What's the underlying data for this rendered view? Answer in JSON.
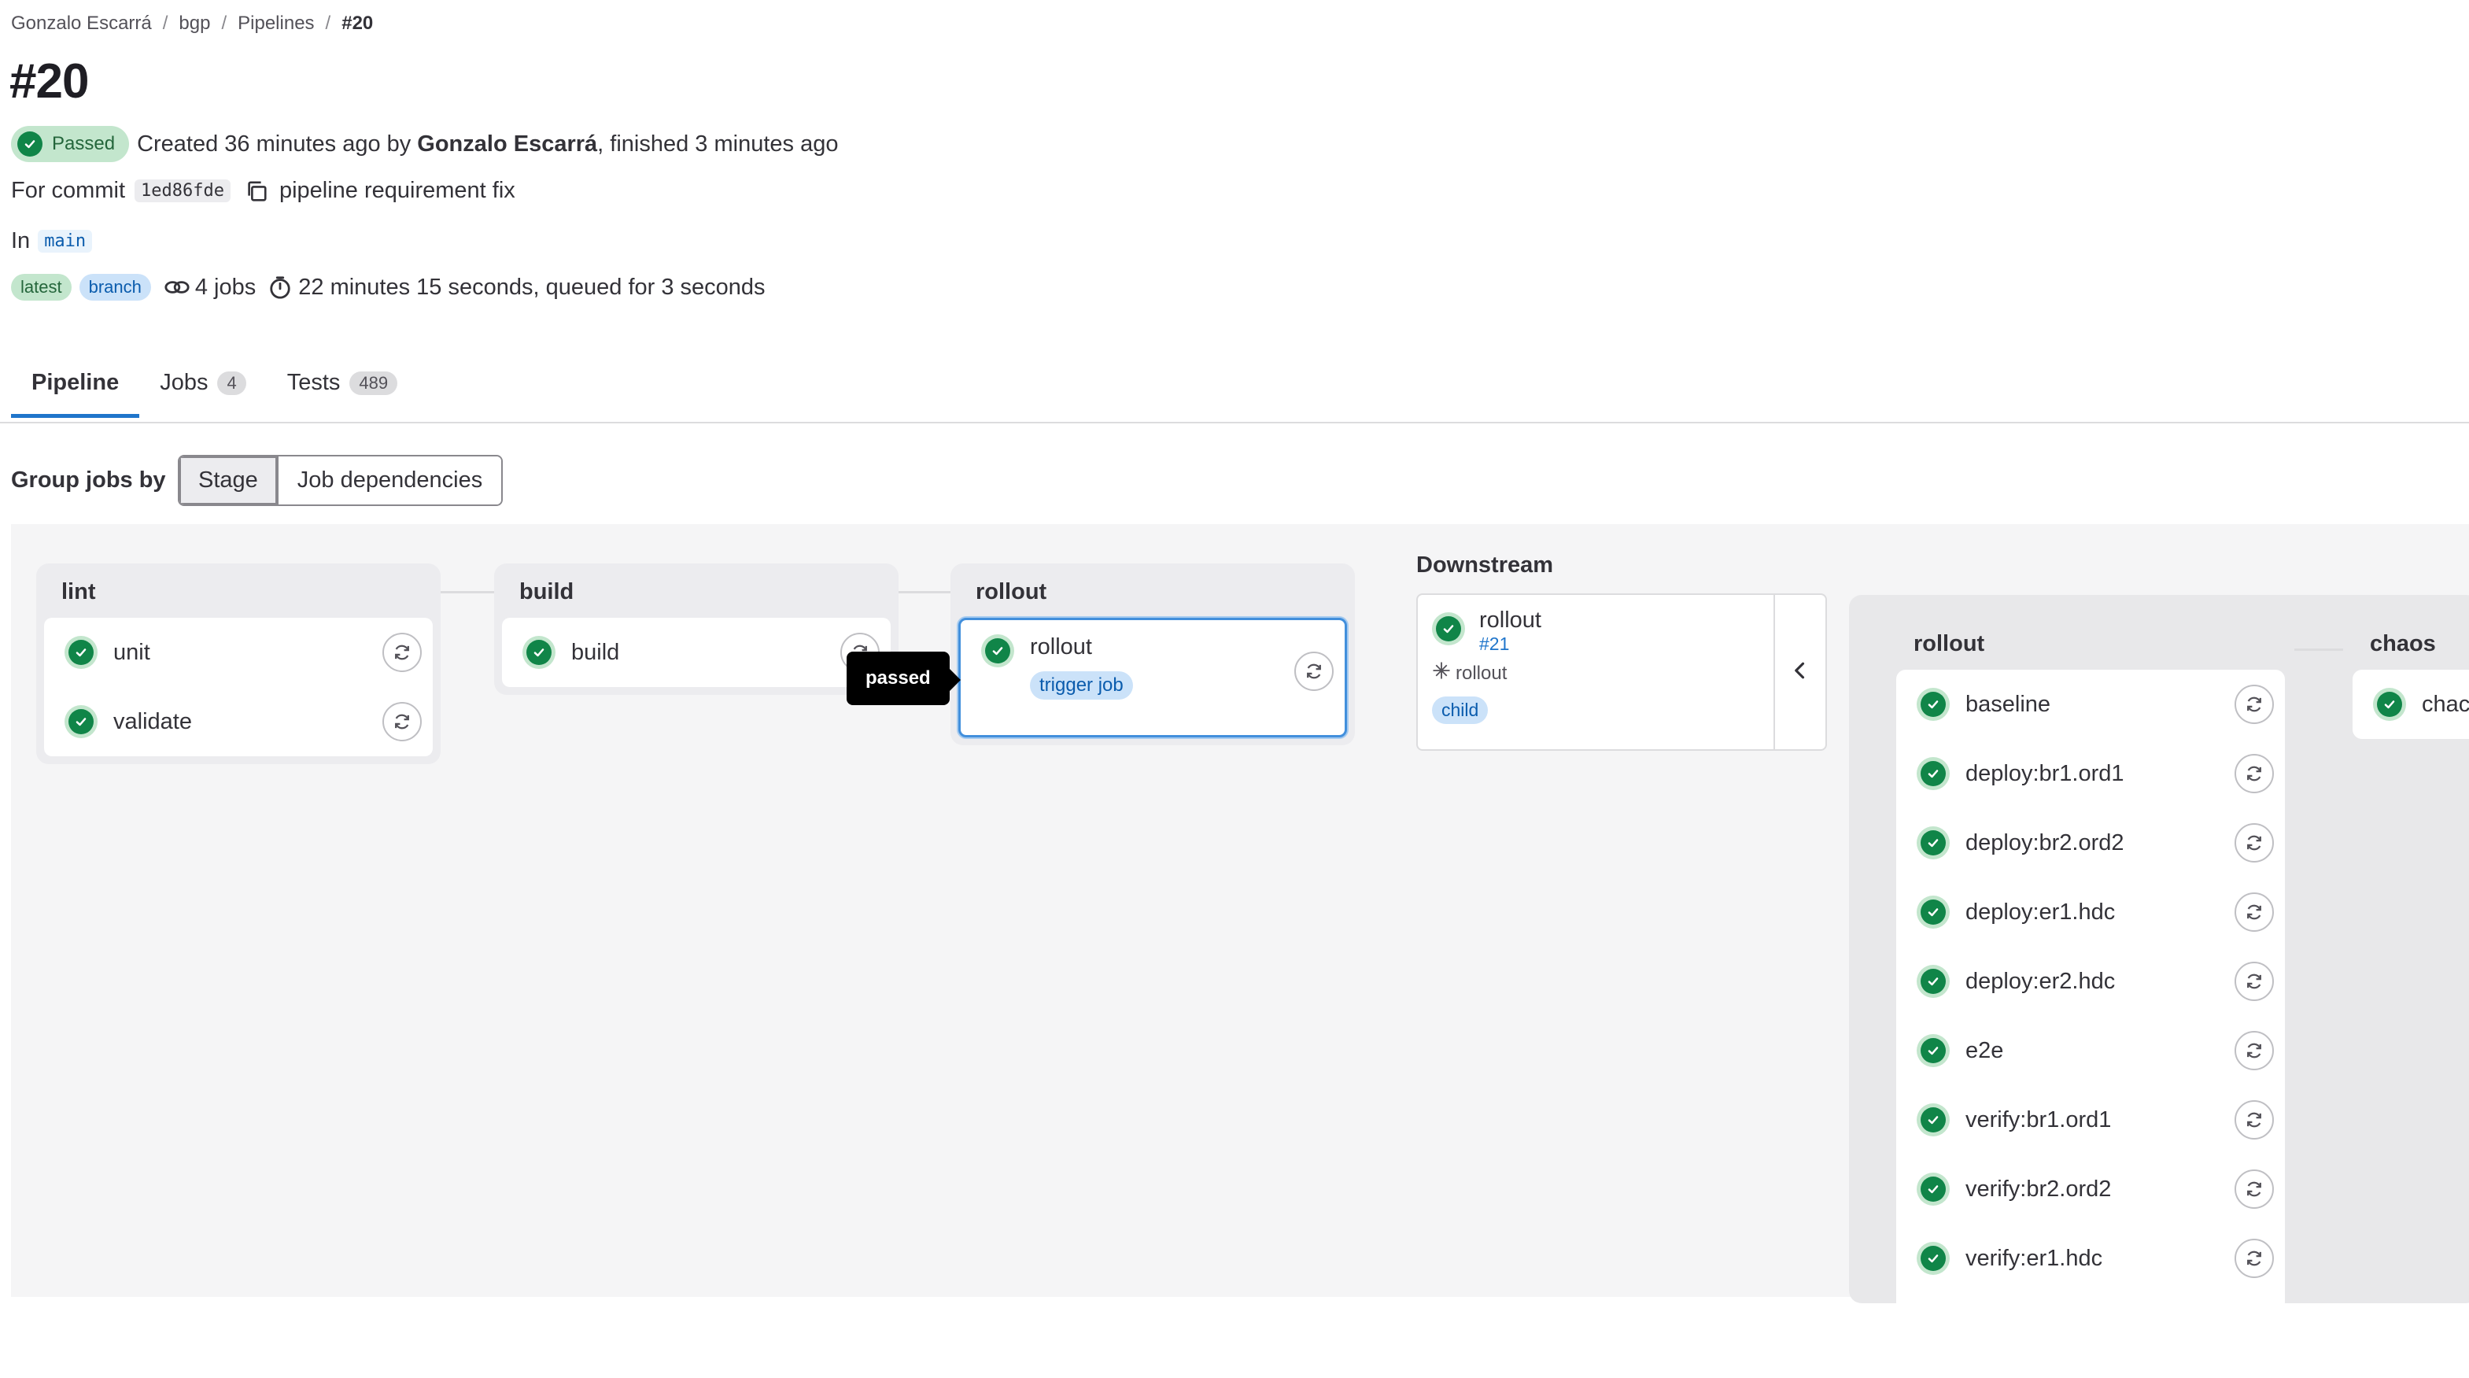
{
  "breadcrumb": {
    "items": [
      "Gonzalo Escarrá",
      "bgp",
      "Pipelines",
      "#20"
    ],
    "separator": "/"
  },
  "page_title": "#20",
  "status": {
    "badge": "Passed",
    "created_prefix": "Created 36 minutes ago by",
    "author": "Gonzalo Escarrá",
    "finished_suffix": ", finished 3 minutes ago"
  },
  "commit": {
    "prefix": "For commit",
    "sha": "1ed86fde",
    "message": "pipeline requirement fix"
  },
  "ref": {
    "prefix": "In",
    "branch": "main"
  },
  "meta": {
    "badges": [
      "latest",
      "branch"
    ],
    "jobs": "4 jobs",
    "duration": "22 minutes 15 seconds, queued for 3 seconds"
  },
  "tabs": [
    {
      "label": "Pipeline",
      "count": null
    },
    {
      "label": "Jobs",
      "count": "4"
    },
    {
      "label": "Tests",
      "count": "489"
    }
  ],
  "group_by": {
    "label": "Group jobs by",
    "options": [
      "Stage",
      "Job dependencies"
    ],
    "selected": "Stage"
  },
  "stages": [
    {
      "name": "lint",
      "jobs": [
        "unit",
        "validate"
      ]
    },
    {
      "name": "build",
      "jobs": [
        "build"
      ]
    },
    {
      "name": "rollout",
      "jobs": [
        "rollout"
      ],
      "job_badge": "trigger job"
    }
  ],
  "tooltip": "passed",
  "downstream": {
    "title": "Downstream",
    "pipeline_name": "rollout",
    "pipeline_id": "#21",
    "source_job": "rollout",
    "badge": "child"
  },
  "child_pipeline": {
    "stages": [
      {
        "name": "rollout",
        "jobs": [
          "baseline",
          "deploy:br1.ord1",
          "deploy:br2.ord2",
          "deploy:er1.hdc",
          "deploy:er2.hdc",
          "e2e",
          "verify:br1.ord1",
          "verify:br2.ord2",
          "verify:er1.hdc"
        ]
      },
      {
        "name": "chaos",
        "jobs": [
          "chac"
        ]
      }
    ]
  },
  "colors": {
    "success": "#108548",
    "success_bg": "#c3e6cd",
    "link": "#1f75cb",
    "canvas_bg": "#f5f5f6"
  },
  "icons": [
    "check-circle-icon",
    "retry-icon",
    "copy-icon",
    "jobs-link-icon",
    "timer-icon",
    "chevron-left-icon",
    "trigger-icon"
  ]
}
